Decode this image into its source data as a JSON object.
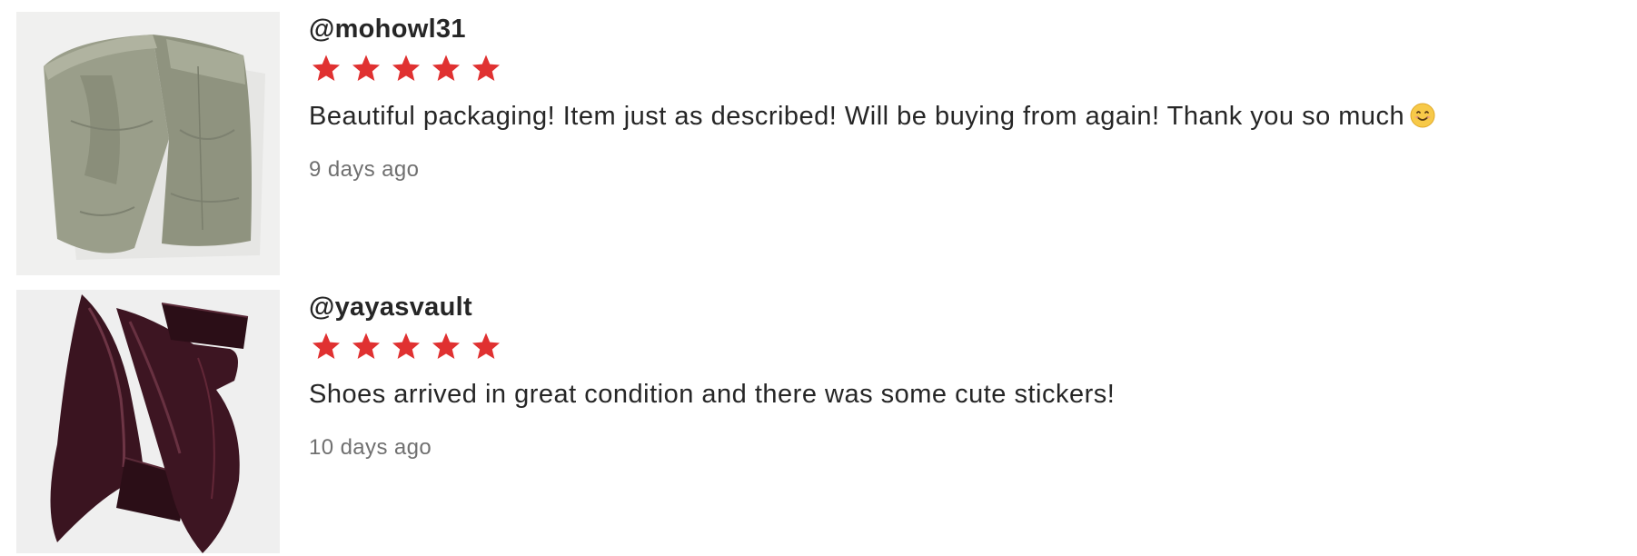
{
  "colors": {
    "star": "#e03131",
    "text": "#262626",
    "muted": "#707070"
  },
  "reviews": [
    {
      "image": "olive-cargo-pants-photo",
      "username": "@mohowl31",
      "rating": 5,
      "text": "Beautiful packaging! Item just as described! Will be buying from again! Thank you so much",
      "emoji": "smiling-face-emoji",
      "time": "9 days ago"
    },
    {
      "image": "burgundy-patent-heels-photo",
      "username": "@yayasvault",
      "rating": 5,
      "text": "Shoes arrived in great condition and there was some cute stickers!",
      "time": "10 days ago"
    }
  ]
}
